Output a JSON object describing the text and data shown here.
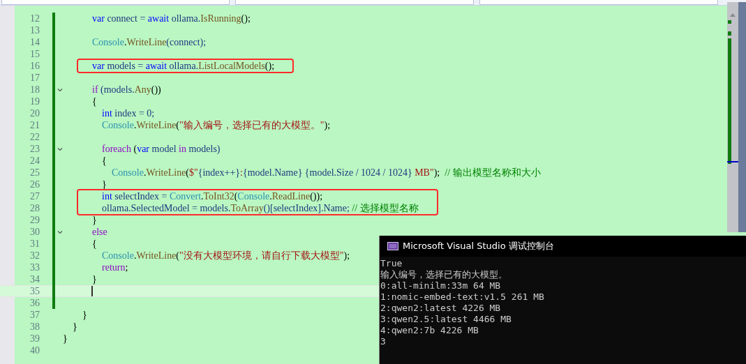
{
  "editor": {
    "lines": [
      {
        "no": "12",
        "changed": true,
        "fold": false,
        "boxed": false,
        "current": false,
        "tokens": [
          {
            "t": "            var",
            "kind": "kw"
          },
          {
            "t": " connect = ",
            "kind": "id"
          },
          {
            "t": "await",
            "kind": "kw"
          },
          {
            "t": " ollama.",
            "kind": "id"
          },
          {
            "t": "IsRunning",
            "kind": "m"
          },
          {
            "t": "();",
            "kind": "p"
          }
        ]
      },
      {
        "no": "13",
        "changed": true,
        "fold": false,
        "boxed": false,
        "current": false
      },
      {
        "no": "14",
        "changed": true,
        "fold": false,
        "boxed": false,
        "current": false,
        "tokens": [
          {
            "t": "            Console",
            "kind": "type"
          },
          {
            "t": ".",
            "kind": "p"
          },
          {
            "t": "WriteLine",
            "kind": "m"
          },
          {
            "t": "(connect);",
            "kind": "id"
          }
        ]
      },
      {
        "no": "15",
        "changed": true,
        "fold": false,
        "boxed": false,
        "current": false
      },
      {
        "no": "16",
        "changed": true,
        "fold": false,
        "boxed": true,
        "current": false,
        "tokens": [
          {
            "t": "            var",
            "kind": "kw"
          },
          {
            "t": " models = ",
            "kind": "id"
          },
          {
            "t": "await",
            "kind": "kw"
          },
          {
            "t": " ollama.",
            "kind": "id"
          },
          {
            "t": "ListLocalModels",
            "kind": "m"
          },
          {
            "t": "();",
            "kind": "p"
          }
        ]
      },
      {
        "no": "17",
        "changed": true,
        "fold": false,
        "boxed": false,
        "current": false
      },
      {
        "no": "18",
        "changed": true,
        "fold": true,
        "boxed": false,
        "current": false,
        "tokens": [
          {
            "t": "            if",
            "kind": "ctrl"
          },
          {
            "t": " (models.",
            "kind": "id"
          },
          {
            "t": "Any",
            "kind": "m"
          },
          {
            "t": "())",
            "kind": "p"
          }
        ]
      },
      {
        "no": "19",
        "changed": true,
        "fold": false,
        "boxed": false,
        "current": false,
        "tokens": [
          {
            "t": "            {",
            "kind": "p"
          }
        ]
      },
      {
        "no": "20",
        "changed": true,
        "fold": false,
        "boxed": false,
        "current": false,
        "tokens": [
          {
            "t": "                int",
            "kind": "kw"
          },
          {
            "t": " index = 0;",
            "kind": "id"
          }
        ]
      },
      {
        "no": "21",
        "changed": true,
        "fold": false,
        "boxed": false,
        "current": false,
        "tokens": [
          {
            "t": "                Console",
            "kind": "type"
          },
          {
            "t": ".",
            "kind": "p"
          },
          {
            "t": "WriteLine",
            "kind": "m"
          },
          {
            "t": "(",
            "kind": "p"
          },
          {
            "t": "\"输入编号，选择已有的大模型。\"",
            "kind": "str"
          },
          {
            "t": ");",
            "kind": "p"
          }
        ]
      },
      {
        "no": "22",
        "changed": true,
        "fold": false,
        "boxed": false,
        "current": false
      },
      {
        "no": "23",
        "changed": true,
        "fold": true,
        "boxed": false,
        "current": false,
        "tokens": [
          {
            "t": "                foreach",
            "kind": "ctrl"
          },
          {
            "t": " (",
            "kind": "p"
          },
          {
            "t": "var",
            "kind": "kw"
          },
          {
            "t": " model ",
            "kind": "id"
          },
          {
            "t": "in",
            "kind": "ctrl"
          },
          {
            "t": " models)",
            "kind": "id"
          }
        ]
      },
      {
        "no": "24",
        "changed": true,
        "fold": false,
        "boxed": false,
        "current": false,
        "tokens": [
          {
            "t": "                {",
            "kind": "p"
          }
        ]
      },
      {
        "no": "25",
        "changed": true,
        "fold": false,
        "boxed": false,
        "current": false,
        "tokens": [
          {
            "t": "                    Console",
            "kind": "type"
          },
          {
            "t": ".",
            "kind": "p"
          },
          {
            "t": "WriteLine",
            "kind": "m"
          },
          {
            "t": "(",
            "kind": "p"
          },
          {
            "t": "$\"",
            "kind": "str"
          },
          {
            "t": "{index++}",
            "kind": "id"
          },
          {
            "t": ":",
            "kind": "str"
          },
          {
            "t": "{model.Name} {model.Size / 1024 / 1024}",
            "kind": "id"
          },
          {
            "t": " MB\"",
            "kind": "str"
          },
          {
            "t": ");  ",
            "kind": "p"
          },
          {
            "t": "// 输出模型名称和大小",
            "kind": "comment"
          }
        ]
      },
      {
        "no": "26",
        "changed": true,
        "fold": false,
        "boxed": false,
        "current": false,
        "tokens": [
          {
            "t": "                }",
            "kind": "p"
          }
        ]
      },
      {
        "no": "27",
        "changed": true,
        "fold": false,
        "boxed": true,
        "current": false,
        "tokens": [
          {
            "t": "                int",
            "kind": "kw"
          },
          {
            "t": " selectIndex = ",
            "kind": "id"
          },
          {
            "t": "Convert",
            "kind": "type"
          },
          {
            "t": ".",
            "kind": "p"
          },
          {
            "t": "ToInt32",
            "kind": "m"
          },
          {
            "t": "(",
            "kind": "p"
          },
          {
            "t": "Console",
            "kind": "type"
          },
          {
            "t": ".",
            "kind": "p"
          },
          {
            "t": "ReadLine",
            "kind": "m"
          },
          {
            "t": "());",
            "kind": "p"
          }
        ]
      },
      {
        "no": "28",
        "changed": true,
        "fold": false,
        "boxed": true,
        "current": false,
        "tokens": [
          {
            "t": "                ollama.SelectedModel = models.",
            "kind": "id"
          },
          {
            "t": "ToArray",
            "kind": "m"
          },
          {
            "t": "()[selectIndex].Name; ",
            "kind": "id"
          },
          {
            "t": "// 选择模型名称",
            "kind": "comment"
          }
        ]
      },
      {
        "no": "29",
        "changed": true,
        "fold": false,
        "boxed": false,
        "current": false,
        "tokens": [
          {
            "t": "            }",
            "kind": "p"
          }
        ]
      },
      {
        "no": "30",
        "changed": true,
        "fold": true,
        "boxed": false,
        "current": false,
        "tokens": [
          {
            "t": "            else",
            "kind": "ctrl"
          }
        ]
      },
      {
        "no": "31",
        "changed": true,
        "fold": false,
        "boxed": false,
        "current": false,
        "tokens": [
          {
            "t": "            {",
            "kind": "p"
          }
        ]
      },
      {
        "no": "32",
        "changed": true,
        "fold": false,
        "boxed": false,
        "current": false,
        "tokens": [
          {
            "t": "                Console",
            "kind": "type"
          },
          {
            "t": ".",
            "kind": "p"
          },
          {
            "t": "WriteLine",
            "kind": "m"
          },
          {
            "t": "(",
            "kind": "p"
          },
          {
            "t": "\"没有大模型环境，请自行下载大模型\"",
            "kind": "str"
          },
          {
            "t": ");",
            "kind": "p"
          }
        ]
      },
      {
        "no": "33",
        "changed": true,
        "fold": false,
        "boxed": false,
        "current": false,
        "tokens": [
          {
            "t": "                return",
            "kind": "ctrl"
          },
          {
            "t": ";",
            "kind": "p"
          }
        ]
      },
      {
        "no": "34",
        "changed": true,
        "fold": false,
        "boxed": false,
        "current": false,
        "tokens": [
          {
            "t": "            }",
            "kind": "p"
          }
        ]
      },
      {
        "no": "35",
        "changed": true,
        "fold": false,
        "boxed": false,
        "current": true
      },
      {
        "no": "36",
        "changed": true,
        "fold": false,
        "boxed": false,
        "current": false
      },
      {
        "no": "37",
        "changed": false,
        "fold": false,
        "boxed": false,
        "current": false,
        "tokens": [
          {
            "t": "        }",
            "kind": "p"
          }
        ]
      },
      {
        "no": "38",
        "changed": false,
        "fold": false,
        "boxed": false,
        "current": false,
        "tokens": [
          {
            "t": "    }",
            "kind": "p"
          }
        ]
      },
      {
        "no": "39",
        "changed": false,
        "fold": false,
        "boxed": false,
        "current": false,
        "tokens": [
          {
            "t": "}",
            "kind": "p"
          }
        ]
      },
      {
        "no": "40",
        "changed": false,
        "fold": false,
        "boxed": false,
        "current": false
      }
    ]
  },
  "console": {
    "title": "Microsoft Visual Studio 调试控制台",
    "output": [
      "True",
      "输入编号，选择已有的大模型。",
      "0:all-minilm:33m 64 MB",
      "1:nomic-embed-text:v1.5 261 MB",
      "2:qwen2:latest 4226 MB",
      "3:qwen2.5:latest 4466 MB",
      "4:qwen2:7b 4226 MB",
      "3"
    ]
  }
}
